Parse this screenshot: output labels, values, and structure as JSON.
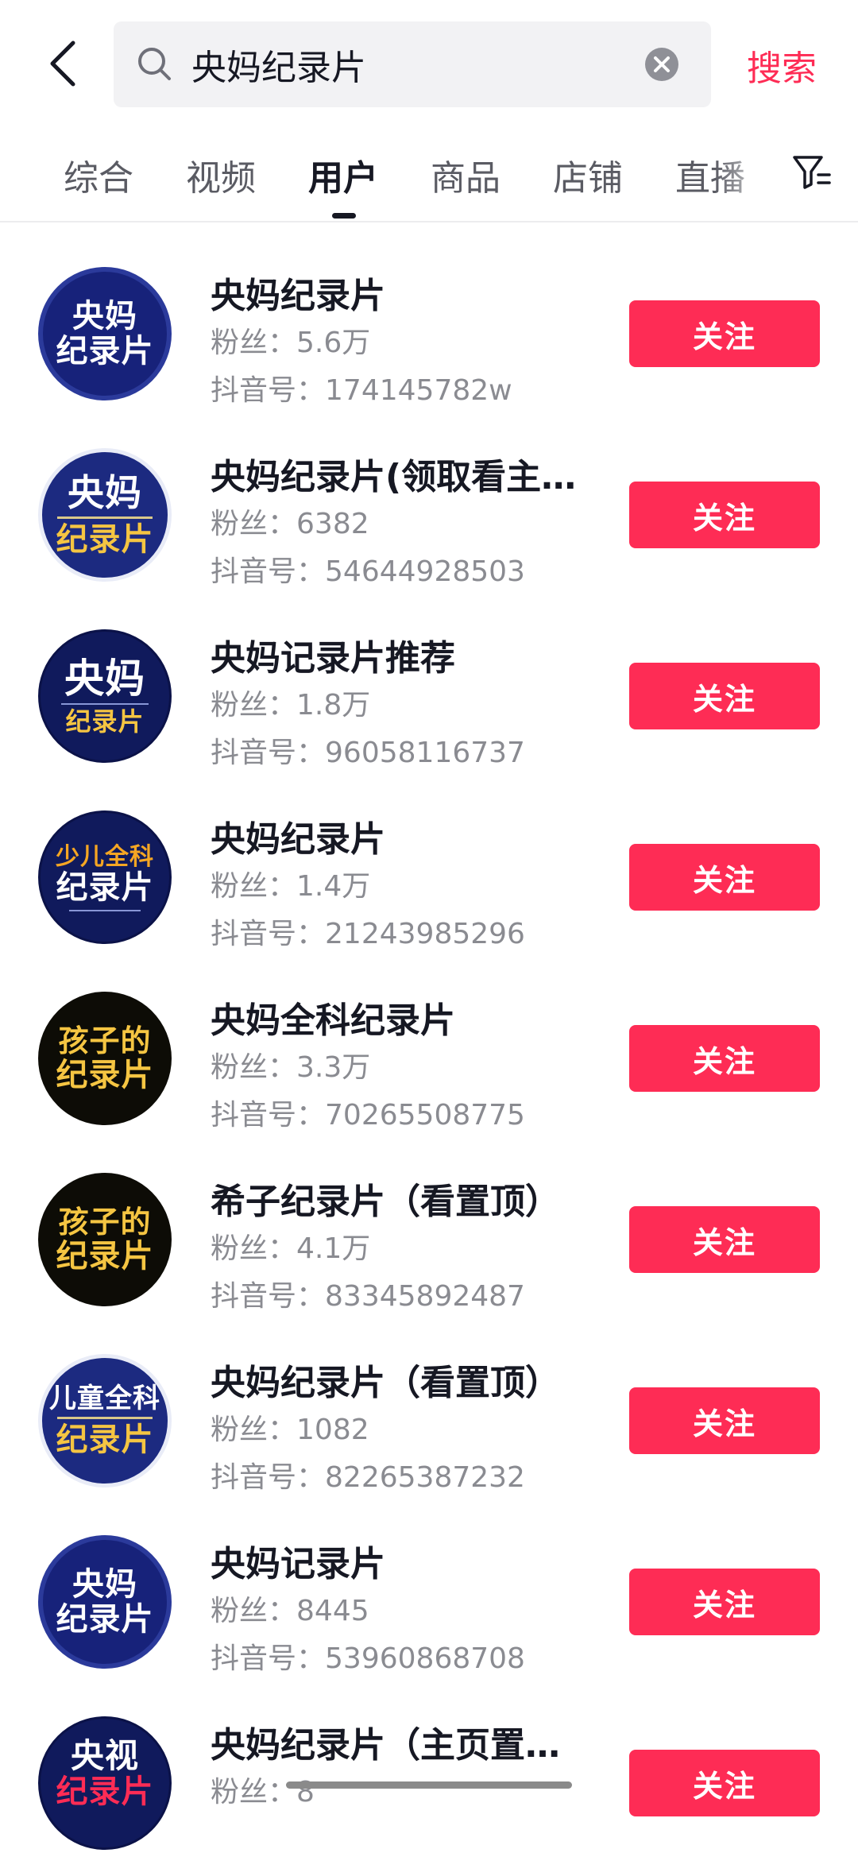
{
  "search": {
    "query": "央妈纪录片",
    "button_label": "搜索"
  },
  "icons": {
    "back": "chevron-left-icon",
    "search": "search-icon",
    "clear": "clear-circle-icon",
    "filter": "filter-icon"
  },
  "tabs": [
    {
      "label": "综合",
      "active": false
    },
    {
      "label": "视频",
      "active": false
    },
    {
      "label": "用户",
      "active": true
    },
    {
      "label": "商品",
      "active": false
    },
    {
      "label": "店铺",
      "active": false
    },
    {
      "label": "直播",
      "active": false
    }
  ],
  "labels": {
    "fans": "粉丝：",
    "douyin_id": "抖音号：",
    "follow": "关注"
  },
  "colors": {
    "accent": "#fe2c55",
    "text": "#161823",
    "secondary_text": "#8a8b91"
  },
  "users": [
    {
      "name": "央妈纪录片",
      "fans": "5.6万",
      "douyin_id": "174145782w",
      "avatar_lines": [
        "央妈",
        "纪录片"
      ]
    },
    {
      "name": "央妈纪录片(领取看主…",
      "fans": "6382",
      "douyin_id": "54644928503",
      "avatar_lines": [
        "央妈",
        "纪录片"
      ]
    },
    {
      "name": "央妈记录片推荐",
      "fans": "1.8万",
      "douyin_id": "96058116737",
      "avatar_lines": [
        "央妈",
        "纪录片"
      ]
    },
    {
      "name": "央妈纪录片",
      "fans": "1.4万",
      "douyin_id": "21243985296",
      "avatar_lines": [
        "少儿全科",
        "纪录片"
      ]
    },
    {
      "name": "央妈全科纪录片",
      "fans": "3.3万",
      "douyin_id": "70265508775",
      "avatar_lines": [
        "孩子的",
        "纪录片"
      ]
    },
    {
      "name": "希子纪录片（看置顶）",
      "fans": "4.1万",
      "douyin_id": "83345892487",
      "avatar_lines": [
        "孩子的",
        "纪录片"
      ]
    },
    {
      "name": "央妈纪录片（看置顶）",
      "fans": "1082",
      "douyin_id": "82265387232",
      "avatar_lines": [
        "儿童全科",
        "纪录片"
      ]
    },
    {
      "name": "央妈记录片",
      "fans": "8445",
      "douyin_id": "53960868708",
      "avatar_lines": [
        "央妈",
        "纪录片"
      ]
    },
    {
      "name": "央妈纪录片（主页置鼎…",
      "fans": "8",
      "douyin_id": "",
      "avatar_lines": [
        "央视",
        "纪录片"
      ]
    }
  ]
}
